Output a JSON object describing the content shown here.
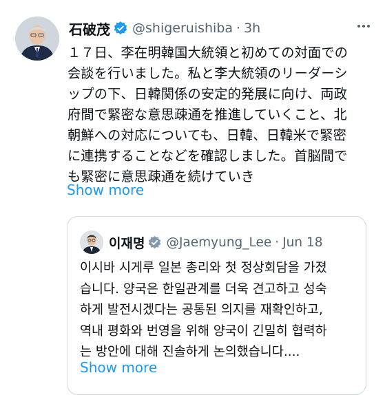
{
  "post": {
    "display_name": "石破茂",
    "handle": "@shigeruishiba",
    "separator": "·",
    "time": "3h",
    "text": "１７日、李在明韓国大統領と初めての対面での\n会談を行いました。私と李大統領のリーダーシ\nップの下、日韓関係の安定的発展に向け、両政\n府間で緊密な意思疎通を推進していくこと、北\n朝鮮への対応についても、日韓、日韓米で緊密\nに連携することなどを確認しました。首脳間で\nも緊密に意思疎通を続けていき",
    "show_more": "Show more"
  },
  "quoted_post": {
    "display_name": "이재명",
    "handle": "@Jaemyung_Lee",
    "separator": "·",
    "time": "Jun 18",
    "text": "이시바 시게루 일본 총리와 첫 정상회담을 가졌\n습니다. 양국은 한일관계를 더욱 견고하고 성숙\n하게 발전시겠다는 공통된 의지를 재확인하고,\n역내 평화와 번영을 위해 양국이 긴밀히 협력하\n는 방안에 대해 진솔하게 논의했습니다....",
    "show_more": "Show more"
  },
  "colors": {
    "accent": "#1d9bf0",
    "secondary_text": "#536471",
    "border": "#cfd9de",
    "verified": "#1d9bf0"
  },
  "icons": {
    "verified": "verified-badge-icon",
    "more": "more-options-icon"
  }
}
